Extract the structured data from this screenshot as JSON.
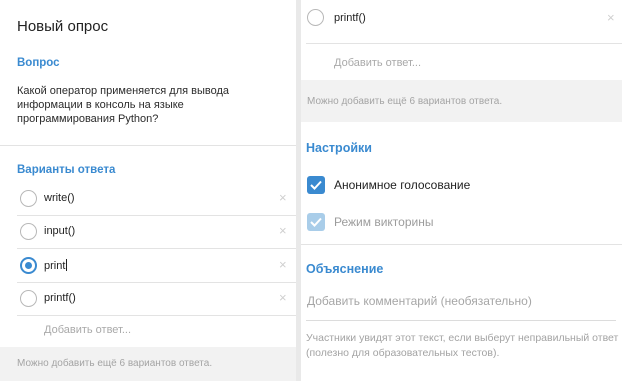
{
  "left": {
    "title": "Новый опрос",
    "question_label": "Вопрос",
    "question_text": "Какой оператор применяется для вывода информации в консоль на языке программирования Python?",
    "answers_label": "Варианты ответа",
    "options": [
      {
        "text": "write()",
        "selected": false
      },
      {
        "text": "input()",
        "selected": false
      },
      {
        "text": "print",
        "selected": true
      },
      {
        "text": "printf()",
        "selected": false
      }
    ],
    "add_answer_placeholder": "Добавить ответ...",
    "hint": "Можно добавить ещё 6 вариантов ответа."
  },
  "right": {
    "top_option_text": "printf()",
    "add_answer_placeholder": "Добавить ответ...",
    "hint": "Можно добавить ещё 6 вариантов ответа.",
    "settings_label": "Настройки",
    "anonymous_label": "Анонимное голосование",
    "anonymous_checked": true,
    "quiz_label": "Режим викторины",
    "quiz_checked": true,
    "quiz_disabled": true,
    "explanation_label": "Объяснение",
    "explanation_placeholder": "Добавить комментарий (необязательно)",
    "explanation_note": "Участники увидят этот текст, если выберут неправильный ответ (полезно для образовательных тестов)."
  },
  "icons": {
    "close": "close-icon",
    "check": "checkmark-icon"
  },
  "colors": {
    "accent": "#3a8ad0",
    "accent_disabled": "#a9cde9",
    "placeholder": "#a9a9a9",
    "hint_band": "#f2f2f2"
  }
}
